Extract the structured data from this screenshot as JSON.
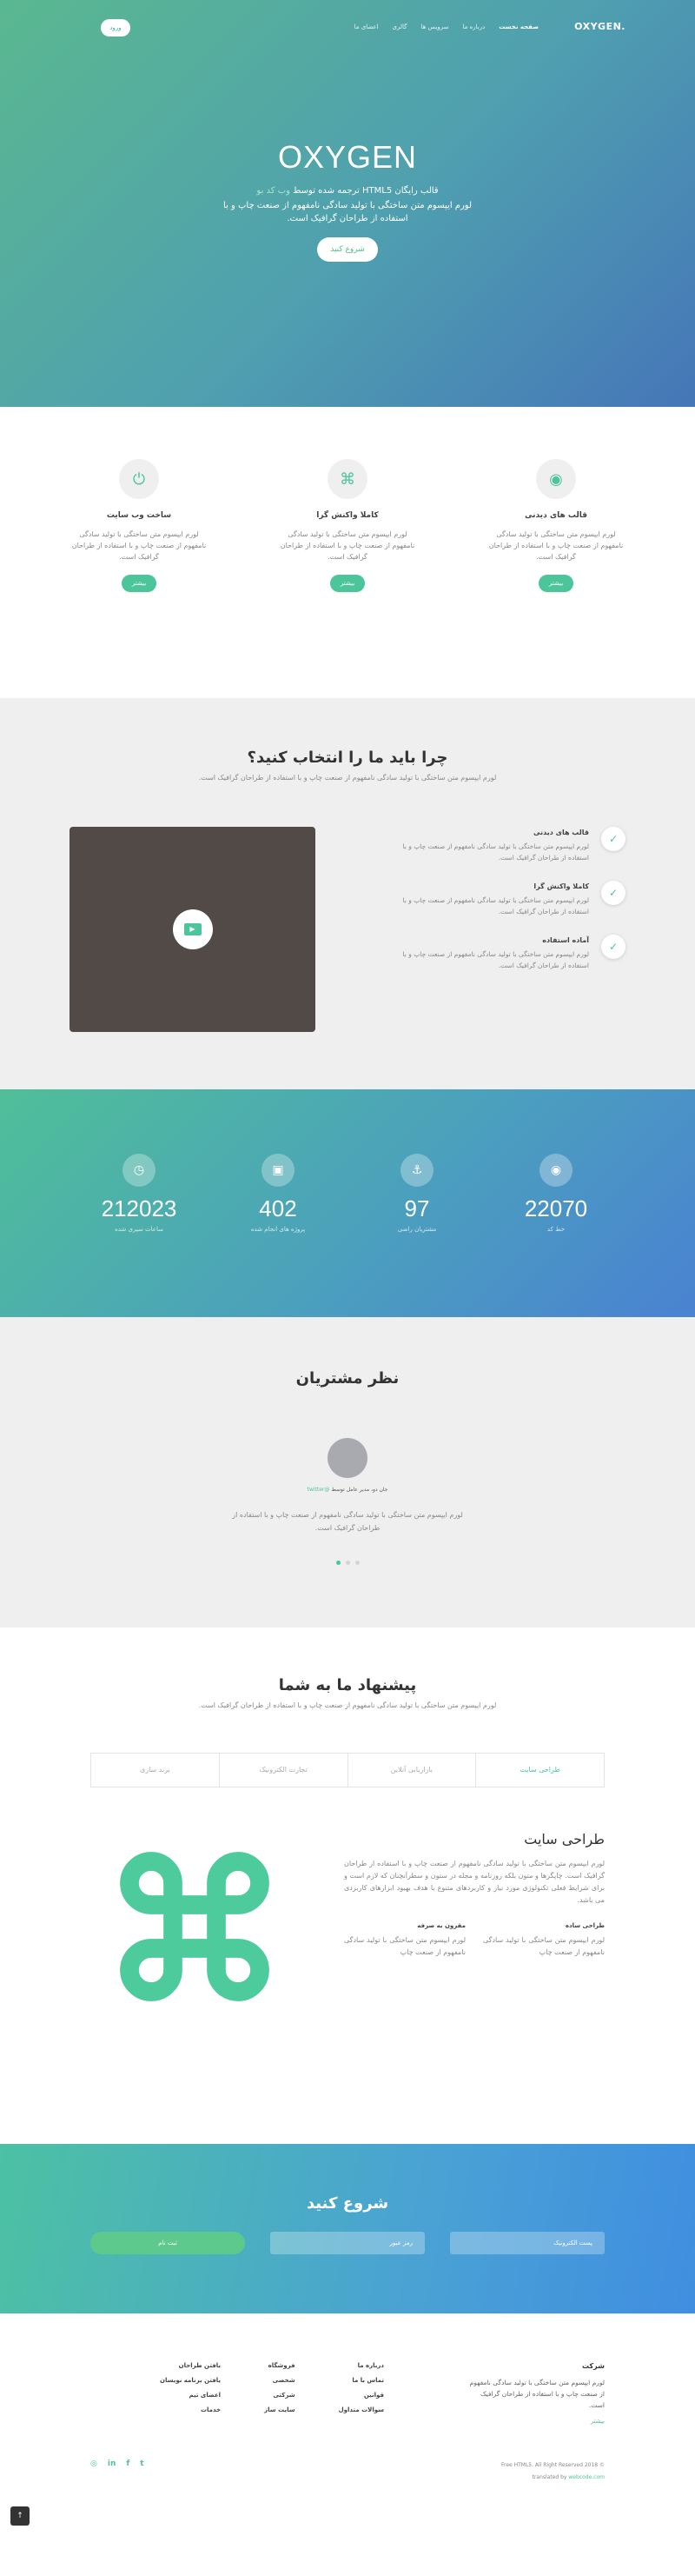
{
  "header": {
    "brand": "OXYGEN.",
    "nav": [
      "صفحه نخست",
      "درباره ما",
      "سرویس ها",
      "گالری",
      "اعضای ما"
    ],
    "action_label": "ورود"
  },
  "hero": {
    "title": "OXYGEN",
    "subtitle_start": "قالب رایگان HTML5 ترجمه شده توسط",
    "subtitle_link": "وب کد بو",
    "text": "لورم ایپسوم متن ساختگی با تولید سادگی نامفهوم از صنعت چاپ و با استفاده از طراحان گرافیک است.",
    "cta": "شروع کنید"
  },
  "features": [
    {
      "icon": "eye-icon",
      "glyph": "◉",
      "title": "قالب های دیدنی",
      "text": "لورم ایپسوم متن ساختگی با تولید سادگی نامفهوم از صنعت چاپ و با استفاده از طراحان گرافیک است.",
      "button": "بیشتر"
    },
    {
      "icon": "command-icon",
      "glyph": "⌘",
      "title": "کاملا واکنش گرا",
      "text": "لورم ایپسوم متن ساختگی با تولید سادگی نامفهوم از صنعت چاپ و با استفاده از طراحان گرافیک است.",
      "button": "بیشتر"
    },
    {
      "icon": "power-icon",
      "glyph": "⏻",
      "title": "ساخت وب سایت",
      "text": "لورم ایپسوم متن ساختگی با تولید سادگی نامفهوم از صنعت چاپ و با استفاده از طراحان گرافیک است.",
      "button": "بیشتر"
    }
  ],
  "why": {
    "title": "چرا باید ما را انتخاب کنید؟",
    "lead": "لورم ایپسوم متن ساختگی با تولید سادگی نامفهوم از صنعت چاپ و با استفاده از طراحان گرافیک است.",
    "items": [
      {
        "title": "قالب های دیدنی",
        "text": "لورم ایپسوم متن ساختگی با تولید سادگی نامفهوم از صنعت چاپ و با استفاده از طراحان گرافیک است."
      },
      {
        "title": "کاملا واکنش گرا",
        "text": "لورم ایپسوم متن ساختگی با تولید سادگی نامفهوم از صنعت چاپ و با استفاده از طراحان گرافیک است."
      },
      {
        "title": "آماده استفاده",
        "text": "لورم ایپسوم متن ساختگی با تولید سادگی نامفهوم از صنعت چاپ و با استفاده از طراحان گرافیک است."
      }
    ],
    "play_icon": "play-icon"
  },
  "stats": [
    {
      "icon": "eye-icon",
      "glyph": "◉",
      "value": "22070",
      "label": "خط کد"
    },
    {
      "icon": "anchor-icon",
      "glyph": "⚓",
      "value": "97",
      "label": "مشتریان راضی"
    },
    {
      "icon": "briefcase-icon",
      "glyph": "▣",
      "value": "402",
      "label": "پروژه های انجام شده"
    },
    {
      "icon": "clock-icon",
      "glyph": "◷",
      "value": "212023",
      "label": "ساعات سپری شده"
    }
  ],
  "testimonials": {
    "title": "نظر مشتریان",
    "name_link": "@twitter",
    "name_text": "جان دو، مدیر عامل توسط",
    "quote": "لورم ایپسوم متن ساختگی با تولید سادگی نامفهوم از صنعت چاپ و با استفاده از طراحان گرافیک است."
  },
  "offers": {
    "title": "پیشنهاد ما به شما",
    "lead": "لورم ایپسوم متن ساختگی با تولید سادگی نامفهوم از صنعت چاپ و با استفاده از طراحان گرافیک است.",
    "tabs": [
      "طراحی سایت",
      "بازاریابی آنلاین",
      "تجارت الکترونیک",
      "برند سازی"
    ],
    "active_tab": "طراحی سایت",
    "content_title": "طراحی سایت",
    "content_text": "لورم ایپسوم متن ساختگی با تولید سادگی نامفهوم از صنعت چاپ و با استفاده از طراحان گرافیک است. چاپگرها و متون بلکه روزنامه و مجله در ستون و سطرآنچنان که لازم است و برای شرایط فعلی تکنولوژی مورد نیاز و کاربردهای متنوع با هدف بهبود ابزارهای کاربردی می باشد.",
    "sub1_title": "طراحی ساده",
    "sub1_text": "لورم ایپسوم متن ساختگی با تولید سادگی نامفهوم از صنعت چاپ",
    "sub2_title": "مقرون به صرفه",
    "sub2_text": "لورم ایپسوم متن ساختگی با تولید سادگی نامفهوم از صنعت چاپ"
  },
  "start": {
    "title": "شروع کنید",
    "email_placeholder": "پست الکترونیک",
    "password_placeholder": "رمز عبور",
    "button": "ثبت نام"
  },
  "footer": {
    "about_title": "شرکت",
    "about_text": "لورم ایپسوم متن ساختگی با تولید سادگی نامفهوم از صنعت چاپ و با استفاده از طراحان گرافیک است.",
    "about_link": "بیشتر",
    "col1": [
      "درباره ما",
      "تماس با ما",
      "قوانین",
      "سوالات متداول"
    ],
    "col2": [
      "فروشگاه",
      "شخصی",
      "شرکتی",
      "سایت ساز"
    ],
    "col3": [
      "یافتن طراحان",
      "یافتن برنامه نویسان",
      "اعضای تیم",
      "خدمات"
    ],
    "copyright": "Free HTML5. All Right Reserved 2018 ©",
    "translated_prefix": "translated by",
    "translated_by": "webcode.com",
    "social": [
      "twitter-icon",
      "facebook-icon",
      "linkedin-icon",
      "dribbble-icon"
    ],
    "to_top": "↑"
  },
  "colors": {
    "accent": "#4cc59a",
    "hero_start": "#5ab890",
    "hero_end": "#4576b8"
  }
}
